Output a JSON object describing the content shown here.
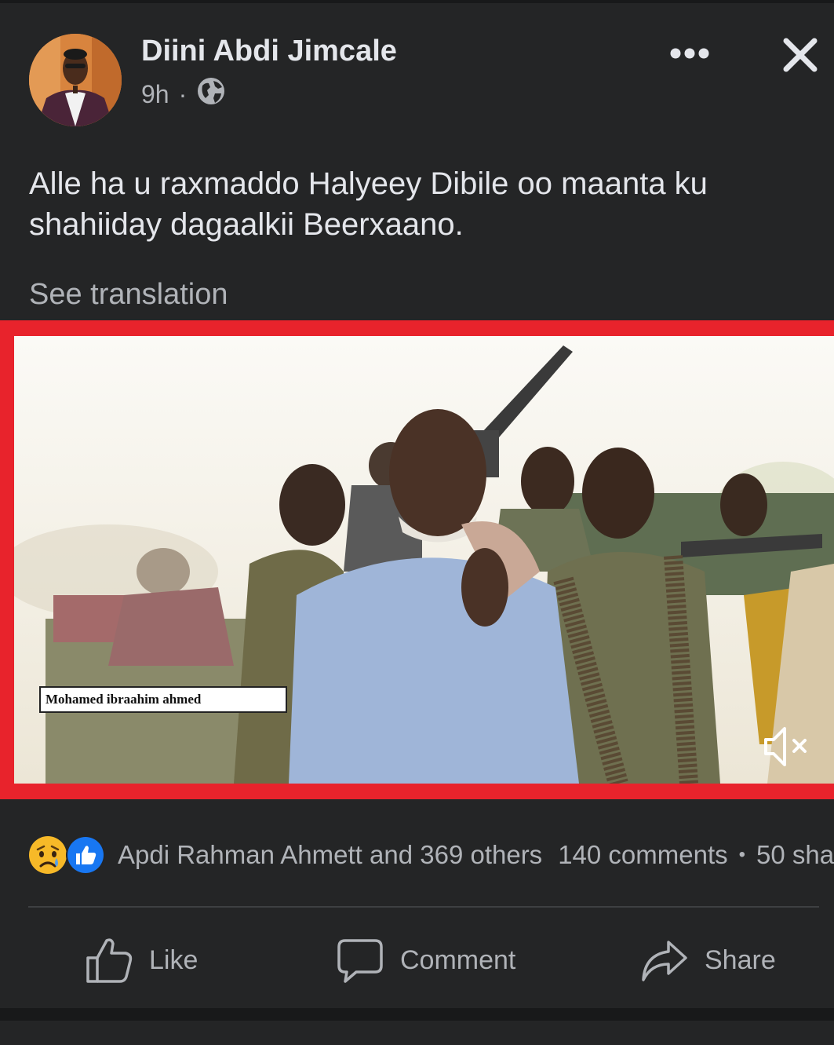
{
  "post": {
    "author": "Diini Abdi Jimcale",
    "time": "9h",
    "separator": "·",
    "privacy_icon": "globe-icon",
    "text": "Alle ha u raxmaddo Halyeey Dibile oo maanta ku shahiiday dagaalkii Beerxaano.",
    "see_translation": "See translation"
  },
  "video": {
    "caption": "Mohamed ibraahim ahmed",
    "border_color": "#e8232c",
    "sound_icon": "muted-speaker-icon"
  },
  "engagement": {
    "reaction_icons": [
      "sad-reaction-icon",
      "like-reaction-icon"
    ],
    "reactions": "Apdi Rahman Ahmett and 369 others",
    "comments": "140 comments",
    "dot": "•",
    "shares": "50 sha"
  },
  "actions": {
    "like": "Like",
    "comment": "Comment",
    "share": "Share"
  },
  "colors": {
    "background": "#18191a",
    "card": "#242526",
    "primary_text": "#e4e6eb",
    "secondary_text": "#b0b3b8",
    "like_blue": "#1877f2"
  }
}
